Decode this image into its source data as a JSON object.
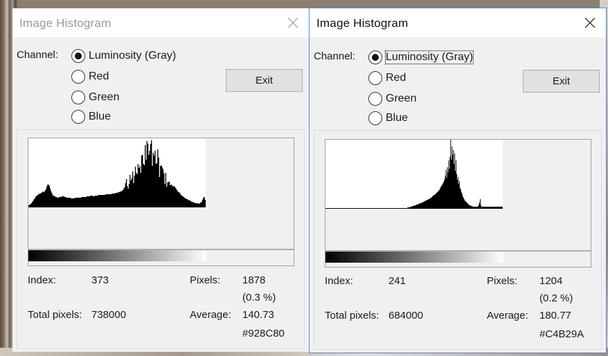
{
  "windows": [
    {
      "title": "Image Histogram",
      "active": false,
      "channel_label": "Channel:",
      "channels": [
        {
          "label": "Luminosity (Gray)",
          "selected": true
        },
        {
          "label": "Red",
          "selected": false
        },
        {
          "label": "Green",
          "selected": false
        },
        {
          "label": "Blue",
          "selected": false
        }
      ],
      "exit_label": "Exit",
      "index_label": "Index:",
      "index_value": "373",
      "pixels_label": "Pixels:",
      "pixels_value": "1878",
      "pixels_percent": "(0.3 %)",
      "total_label": "Total pixels:",
      "total_value": "738000",
      "average_label": "Average:",
      "average_value": "140.73",
      "average_hex": "#928C80"
    },
    {
      "title": "Image Histogram",
      "active": true,
      "channel_label": "Channel:",
      "channels": [
        {
          "label": "Luminosity (Gray)",
          "selected": true
        },
        {
          "label": "Red",
          "selected": false
        },
        {
          "label": "Green",
          "selected": false
        },
        {
          "label": "Blue",
          "selected": false
        }
      ],
      "exit_label": "Exit",
      "index_label": "Index:",
      "index_value": "241",
      "pixels_label": "Pixels:",
      "pixels_value": "1204",
      "pixels_percent": "(0.2 %)",
      "total_label": "Total pixels:",
      "total_value": "684000",
      "average_label": "Average:",
      "average_value": "180.77",
      "average_hex": "#C4B29A"
    }
  ],
  "colors": {
    "window_bg": "#f0f0f0",
    "active_border": "#4a8ad6",
    "button_bg": "#e1e1e1"
  },
  "histograms": [
    {
      "bins": 256,
      "levels": [
        3,
        4,
        5,
        6,
        8,
        10,
        12,
        14,
        16,
        17,
        18,
        19,
        20,
        20,
        21,
        22,
        23,
        22,
        24,
        26,
        30,
        33,
        33,
        31,
        27,
        23,
        20,
        17,
        17,
        16,
        15,
        15,
        14,
        14,
        15,
        15,
        15,
        16,
        16,
        16,
        15,
        15,
        14,
        14,
        14,
        14,
        14,
        13,
        13,
        13,
        13,
        13,
        14,
        14,
        14,
        14,
        14,
        14,
        14,
        15,
        15,
        15,
        15,
        15,
        15,
        16,
        16,
        16,
        16,
        17,
        17,
        17,
        16,
        16,
        17,
        17,
        17,
        17,
        18,
        18,
        18,
        18,
        18,
        18,
        18,
        18,
        19,
        19,
        19,
        19,
        19,
        19,
        19,
        20,
        20,
        20,
        20,
        21,
        21,
        21,
        22,
        22,
        23,
        23,
        24,
        25,
        27,
        29,
        35,
        41,
        31,
        27,
        34,
        47,
        39,
        42,
        52,
        35,
        46,
        59,
        50,
        48,
        63,
        57,
        60,
        50,
        75,
        76,
        63,
        61,
        90,
        69,
        96,
        92,
        76,
        82,
        92,
        97,
        60,
        79,
        75,
        82,
        63,
        64,
        84,
        72,
        44,
        60,
        61,
        58,
        55,
        49,
        34,
        50,
        30,
        36,
        37,
        37,
        32,
        33,
        32,
        30,
        31,
        30,
        28,
        26,
        24,
        22,
        22,
        20,
        18,
        17,
        16,
        15,
        14,
        13,
        12,
        12,
        11,
        10,
        10,
        9,
        8,
        8,
        7,
        7,
        6,
        6,
        6,
        6,
        5,
        6,
        7,
        8,
        11,
        14,
        15,
        11
      ],
      "max": 100
    },
    {
      "bins": 256,
      "levels": [
        1,
        1,
        1,
        1,
        1,
        1,
        1,
        1,
        1,
        1,
        1,
        1,
        1,
        1,
        1,
        1,
        1,
        1,
        1,
        1,
        1,
        1,
        1,
        1,
        1,
        1,
        1,
        1,
        1,
        1,
        1,
        1,
        1,
        1,
        1,
        1,
        1,
        1,
        1,
        1,
        1,
        1,
        1,
        1,
        1,
        1,
        1,
        1,
        1,
        1,
        1,
        1,
        1,
        1,
        1,
        1,
        1,
        1,
        1,
        1,
        1,
        1,
        1,
        1,
        1,
        1,
        1,
        1,
        1,
        1,
        1,
        1,
        1,
        1,
        1,
        1,
        1,
        1,
        1,
        1,
        1,
        1,
        1,
        1,
        1,
        1,
        1,
        1,
        1,
        1,
        1,
        1,
        1,
        1,
        1,
        1,
        1,
        1,
        1,
        1,
        1,
        1,
        1,
        1,
        1,
        1,
        1,
        1,
        1,
        1,
        1,
        1,
        1,
        1,
        1,
        1,
        1,
        1,
        1,
        1,
        1,
        1,
        2,
        2,
        2,
        2,
        3,
        3,
        3,
        4,
        4,
        4,
        5,
        5,
        5,
        6,
        6,
        6,
        7,
        7,
        8,
        8,
        8,
        9,
        9,
        10,
        10,
        11,
        11,
        12,
        12,
        13,
        13,
        14,
        14,
        15,
        15,
        16,
        17,
        18,
        19,
        20,
        20,
        21,
        22,
        23,
        24,
        25,
        26,
        27,
        29,
        31,
        33,
        34,
        36,
        38,
        40,
        43,
        48,
        56,
        45,
        60,
        53,
        70,
        58,
        75,
        100,
        71,
        90,
        78,
        85,
        65,
        80,
        55,
        70,
        50,
        42,
        46,
        36,
        40,
        30,
        28,
        24,
        22,
        18,
        16,
        14,
        12,
        11,
        10,
        9,
        8,
        7,
        6,
        5,
        5,
        4,
        4,
        4,
        3,
        3,
        3,
        3,
        3,
        3,
        3,
        3,
        4,
        6,
        9,
        14,
        5,
        3,
        3,
        3,
        3,
        3,
        3,
        3,
        3,
        3,
        3,
        3,
        3,
        3,
        3,
        3,
        3,
        3,
        3,
        3,
        3,
        3,
        3,
        3,
        3,
        3,
        3,
        3,
        3,
        3,
        3,
        3,
        3
      ],
      "max": 100
    }
  ]
}
